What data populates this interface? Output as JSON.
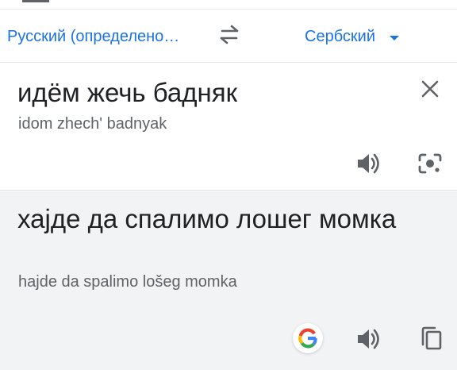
{
  "language_bar": {
    "source_language": "Русский (определено…",
    "target_language": "Сербский",
    "swap_icon": "swap-arrows-icon",
    "dropdown_icon": "caret-down-icon"
  },
  "input": {
    "text": "идём жечь бадняк",
    "transliteration": "idom zhech' badnyak",
    "clear_icon": "close-icon",
    "speaker_icon": "speaker-icon",
    "lens_icon": "camera-lens-icon"
  },
  "output": {
    "text": "хајде да спалимо лошег момка",
    "transliteration": "hajde da spalimo lošeg momka",
    "google_icon": "google-g-icon",
    "speaker_icon": "speaker-icon",
    "copy_icon": "copy-icon"
  },
  "colors": {
    "accent": "#1a73e8",
    "text_primary": "#202124",
    "text_secondary": "#5f6368",
    "output_background": "#f1f3f4"
  }
}
